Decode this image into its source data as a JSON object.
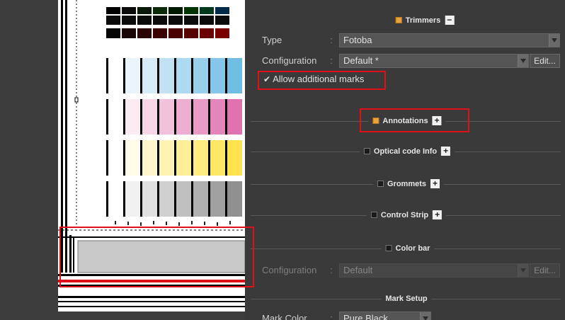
{
  "trimmers": {
    "label": "Trimmers",
    "checked": true
  },
  "type": {
    "label": "Type",
    "value": "Fotoba"
  },
  "configuration": {
    "label": "Configuration",
    "value": "Default *",
    "edit_label": "Edit..."
  },
  "allow_marks": {
    "label": "Allow additional marks",
    "checked": true
  },
  "sections": {
    "annotations": {
      "label": "Annotations",
      "checked": true
    },
    "optical_code": {
      "label": "Optical code Info",
      "checked": false
    },
    "grommets": {
      "label": "Grommets",
      "checked": false
    },
    "control_strip": {
      "label": "Control Strip",
      "checked": false
    },
    "color_bar": {
      "label": "Color bar",
      "checked": false
    }
  },
  "color_bar_config": {
    "label": "Configuration",
    "value": "Default",
    "edit_label": "Edit...",
    "enabled": false
  },
  "mark_setup": {
    "label": "Mark Setup"
  },
  "mark_color": {
    "label": "Mark Color",
    "value": "Pure Black"
  },
  "colors": {
    "accent": "#e8a33a",
    "highlight": "#e0101a"
  }
}
